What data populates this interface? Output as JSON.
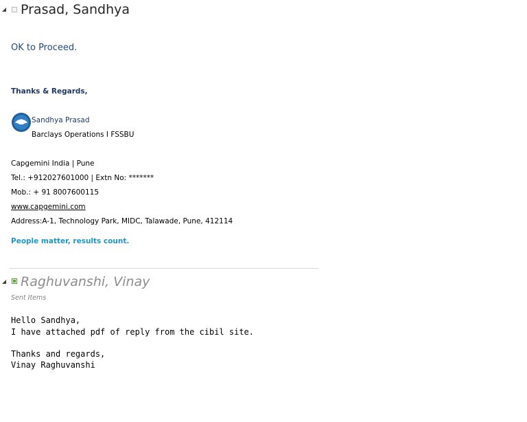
{
  "message1": {
    "sender": "Prasad, Sandhya",
    "body": "OK to Proceed.",
    "signature": {
      "closing": "Thanks  & Regards,",
      "name": "Sandhya Prasad",
      "department": "Barclays Operations I FSSBU",
      "company": "Capgemini India | Pune",
      "tel": "Tel.: +912027601000 | Extn No: *******",
      "mobile": "Mob.: + 91 8007600115",
      "website": "www.capgemini.com",
      "address": "Address:A-1, Technology Park, MIDC, Talawade, Pune, 412114",
      "tagline": "People matter, results count."
    }
  },
  "message2": {
    "sender": "Raghuvanshi, Vinay",
    "folder": "Sent Items",
    "body_lines": [
      "Hello Sandhya,",
      "I have attached pdf of reply from the cibil site.",
      "Thanks and regards,",
      "Vinay Raghuvanshi"
    ]
  },
  "colors": {
    "read_indicator": "#4caf1e",
    "brand_blue": "#1f3864",
    "tagline_blue": "#1f96c0"
  },
  "icons": {
    "collapse": "collapse-arrow-icon",
    "logo": "capgemini-logo-icon"
  }
}
